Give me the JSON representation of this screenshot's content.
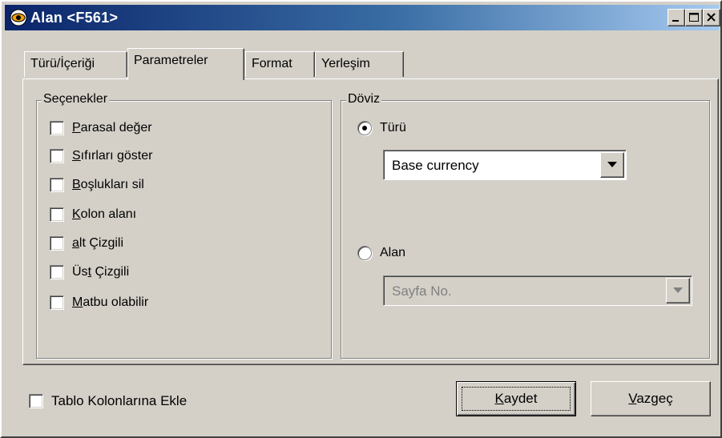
{
  "window": {
    "title": "Alan <F561>",
    "controls": {
      "minimize": "minimize-icon",
      "maximize": "maximize-icon",
      "close": "close-icon"
    }
  },
  "tabs": [
    {
      "label": "Türü/İçeriği",
      "active": false
    },
    {
      "label": "Parametreler",
      "active": true
    },
    {
      "label": "Format",
      "active": false
    },
    {
      "label": "Yerleşim",
      "active": false
    }
  ],
  "options_group": {
    "title": "Seçenekler",
    "items": [
      {
        "accel": "P",
        "rest": "arasal değer",
        "checked": false
      },
      {
        "accel": "S",
        "rest": "ıfırları göster",
        "checked": false
      },
      {
        "accel": "B",
        "rest": "oşlukları sil",
        "checked": false
      },
      {
        "accel": "K",
        "rest": "olon alanı",
        "checked": false
      },
      {
        "accel": "a",
        "rest": "lt Çizgili",
        "checked": false
      },
      {
        "pre": "Üs",
        "accel": "t",
        "rest": " Çizgili",
        "checked": false
      },
      {
        "accel": "M",
        "rest": "atbu olabilir",
        "checked": false
      }
    ]
  },
  "currency_group": {
    "title": "Döviz",
    "radio_type": {
      "label": "Türü",
      "selected": true
    },
    "type_select": {
      "value": "Base currency"
    },
    "radio_field": {
      "label": "Alan",
      "selected": false
    },
    "field_select": {
      "value": "Sayfa No.",
      "disabled": true
    }
  },
  "footer": {
    "add_to_table_columns": {
      "label": "Tablo Kolonlarına Ekle",
      "checked": false
    },
    "save_button": {
      "accel": "K",
      "rest": "aydet"
    },
    "cancel_button": {
      "accel": "V",
      "rest": "azgeç"
    }
  },
  "colors": {
    "face": "#d4d0c8",
    "title_start": "#0a246a",
    "title_end": "#a6caf0"
  }
}
